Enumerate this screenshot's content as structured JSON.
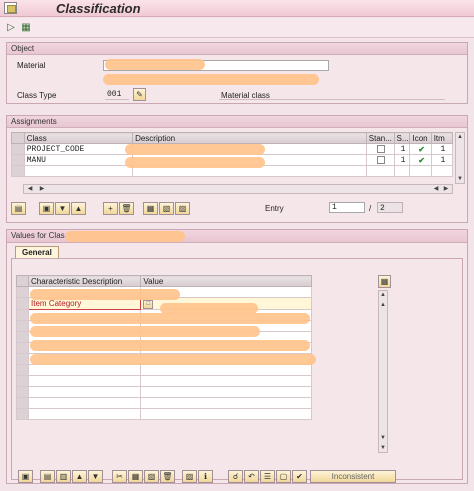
{
  "window": {
    "title": "Classification"
  },
  "object_group": {
    "title": "Object",
    "material_label": "Material",
    "class_type_label": "Class Type",
    "class_type_value": "001",
    "class_type_desc": "Material class"
  },
  "assignments": {
    "title": "Assignments",
    "columns": [
      "Class",
      "Description",
      "Stan...",
      "S...",
      "Icon",
      "Itm"
    ],
    "rows": [
      {
        "class": "PROJECT_CODE",
        "s": "1",
        "itm": "1"
      },
      {
        "class": "MANU",
        "s": "1",
        "itm": "1"
      }
    ],
    "entry_label": "Entry",
    "entry_value": "1",
    "entry_sep": "/",
    "entry_total": "2"
  },
  "values": {
    "title": "Values for Clas",
    "tab": "General",
    "columns": [
      "Characteristic Description",
      "Value"
    ],
    "first_row_label": "Item Category",
    "inconsistent_button": "Inconsistent"
  },
  "colors": {
    "accent": "#f0c9d4",
    "redaction": "#ffc38c"
  }
}
